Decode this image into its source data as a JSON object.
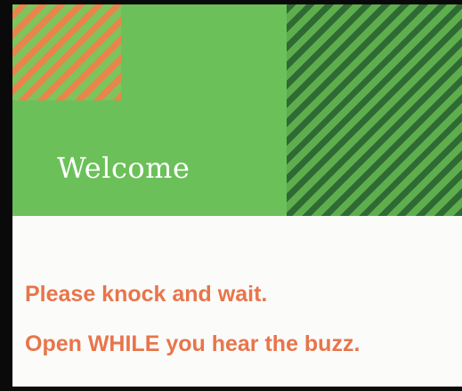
{
  "sign": {
    "greeting": "Welcome",
    "lines": [
      "Please knock and wait.",
      "Open WHILE you hear the buzz."
    ]
  },
  "colors": {
    "banner_green": "#6cc05a",
    "stripe_dark_green": "#2f6a34",
    "stripe_orange": "#e9844a",
    "text_orange": "#e8754a",
    "paper": "#fbfbfa"
  }
}
